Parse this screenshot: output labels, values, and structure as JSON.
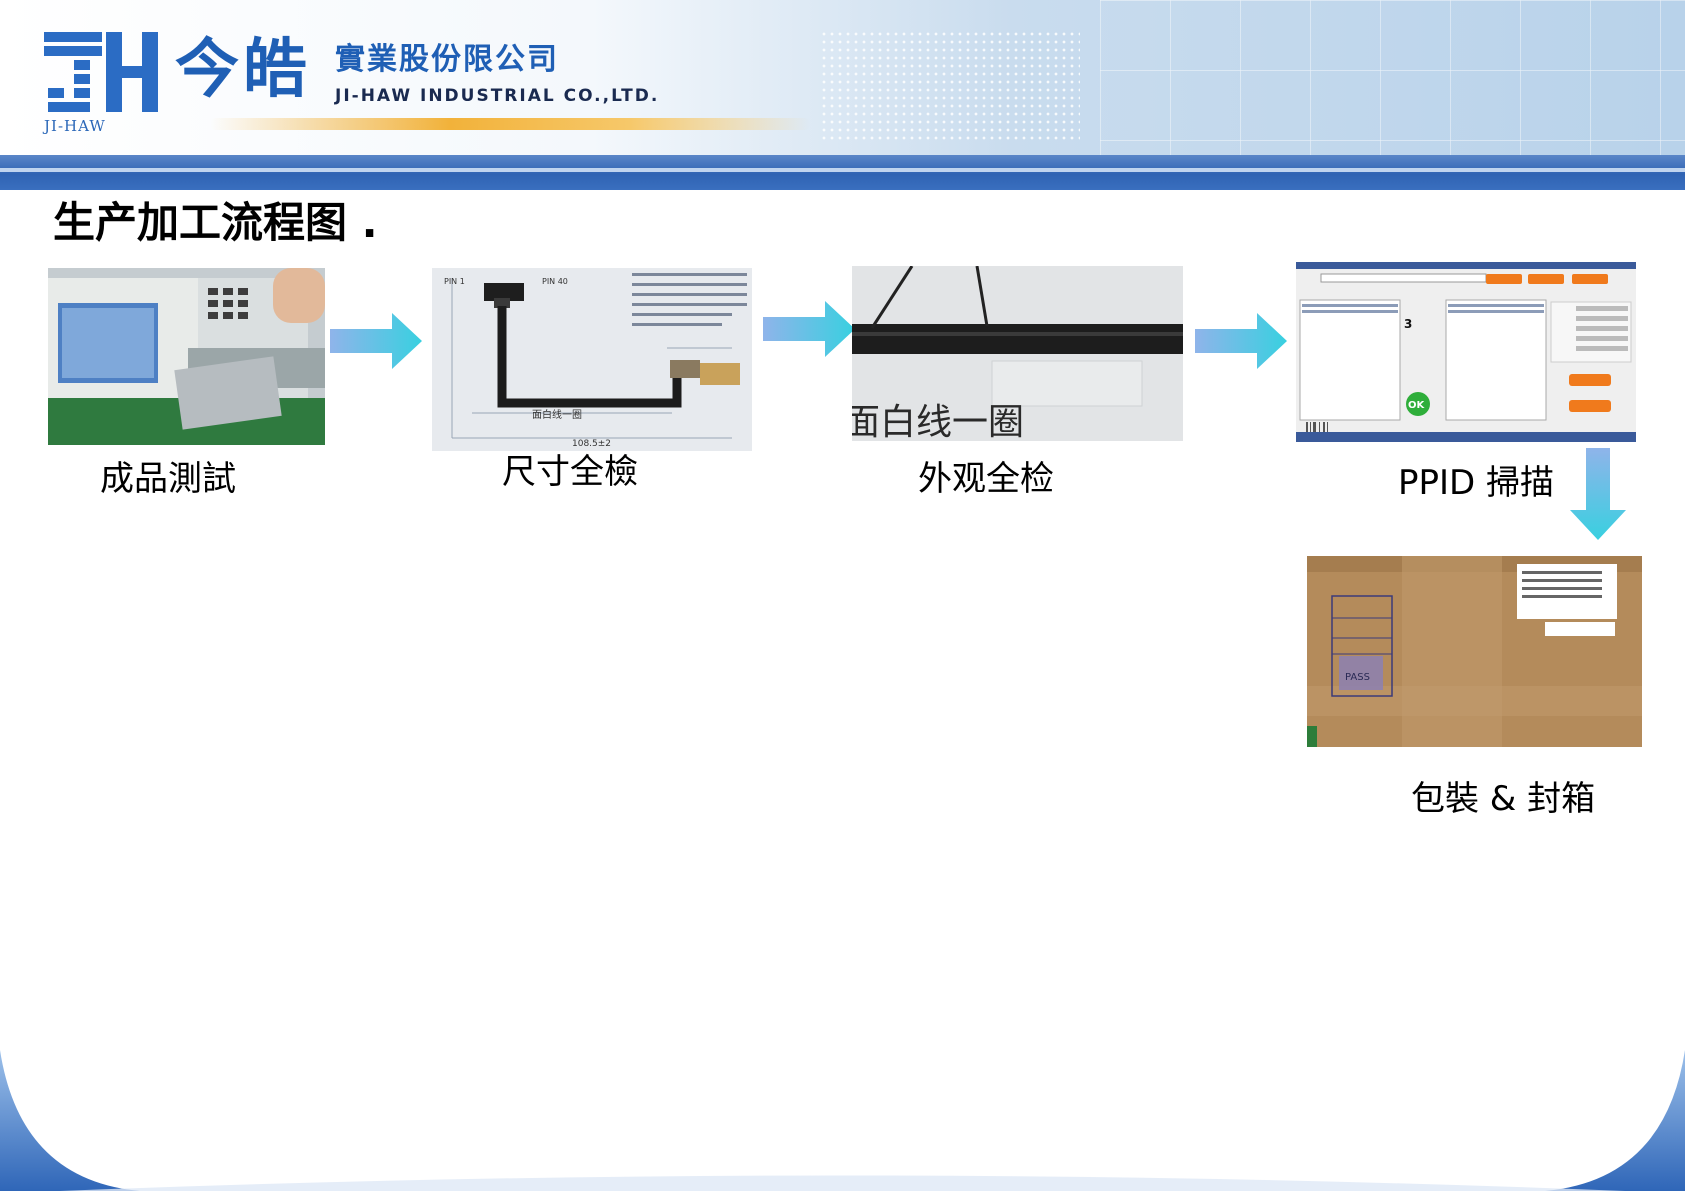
{
  "header": {
    "logo_sub": "JI-HAW",
    "brand_cn": "今皓",
    "company_cn": "實業股份限公司",
    "company_en": "JI-HAW INDUSTRIAL CO.,LTD."
  },
  "page": {
    "title": "生产加工流程图 ."
  },
  "steps": [
    {
      "caption": "成品測試",
      "icon": "tester-photo"
    },
    {
      "caption": "尺寸全檢",
      "icon": "drawing-photo"
    },
    {
      "caption": "外观全检",
      "icon": "cable-photo"
    },
    {
      "caption": "PPID 掃描",
      "icon": "software-screen-photo"
    },
    {
      "caption": "包裝 & 封箱",
      "icon": "carton-box-photo"
    }
  ],
  "photo_texts": {
    "drawing_note": "面白线一圈",
    "drawing_dim": "108.5±2",
    "drawing_pin1": "PIN 1",
    "drawing_pin40": "PIN 40",
    "cable_text": "面白线一圈",
    "software_count": "3",
    "software_ok": "OK",
    "box_pass": "PASS"
  },
  "colors": {
    "brand_blue": "#1f5fb5",
    "arrow_start": "#8fb4ea",
    "arrow_end": "#38d0e0"
  }
}
